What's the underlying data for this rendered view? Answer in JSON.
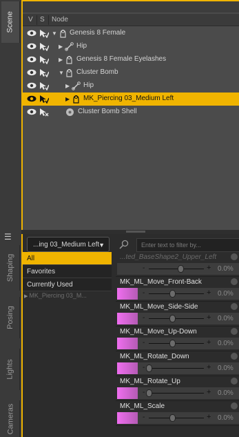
{
  "tabs": {
    "scene": "Scene",
    "shaping": "Shaping",
    "posing": "Posing",
    "lights": "Lights",
    "cameras": "Cameras"
  },
  "header": {
    "v": "V",
    "s": "S",
    "node": "Node"
  },
  "tree": [
    {
      "label": "Genesis 8 Female",
      "expander": "▼",
      "icon": "figure-icon",
      "selected": false
    },
    {
      "label": "Hip",
      "expander": "▶",
      "icon": "bone-icon",
      "selected": false
    },
    {
      "label": "Genesis 8 Female Eyelashes",
      "expander": "▶",
      "icon": "figure-icon",
      "selected": false
    },
    {
      "label": "Cluster Bomb",
      "expander": "▼",
      "icon": "figure-icon",
      "selected": false
    },
    {
      "label": "Hip",
      "expander": "▶",
      "icon": "bone-icon",
      "selected": false
    },
    {
      "label": "MK_Piercing 03_Medium Left",
      "expander": "▶",
      "icon": "figure-icon",
      "selected": true
    },
    {
      "label": "Cluster Bomb Shell",
      "expander": "",
      "icon": "prop-icon",
      "selected": false
    }
  ],
  "lower": {
    "figure_select": "...ing 03_Medium Left",
    "categories": [
      "All",
      "Favorites",
      "Currently Used"
    ],
    "figure_item": "MK_Piercing 03_M...",
    "filter_placeholder": "Enter text to filter by..."
  },
  "sliders": [
    {
      "name": "...ted_BaseShape2_Upper_Left",
      "value": "0.0%",
      "pos": 0.6,
      "faded": true
    },
    {
      "name": "MK_ML_Move_Front-Back",
      "value": "0.0%",
      "pos": 0.45,
      "faded": false
    },
    {
      "name": "MK_ML_Move_Side-Side",
      "value": "0.0%",
      "pos": 0.45,
      "faded": false
    },
    {
      "name": "MK_ML_Move_Up-Down",
      "value": "0.0%",
      "pos": 0.45,
      "faded": false
    },
    {
      "name": "MK_ML_Rotate_Down",
      "value": "0.0%",
      "pos": 0.0,
      "faded": false
    },
    {
      "name": "MK_ML_Rotate_Up",
      "value": "0.0%",
      "pos": 0.0,
      "faded": false
    },
    {
      "name": "MK_ML_Scale",
      "value": "0.0%",
      "pos": 0.45,
      "faded": false
    }
  ],
  "colors": {
    "accent": "#f0b400",
    "slider_pink": "#f06ef0"
  }
}
